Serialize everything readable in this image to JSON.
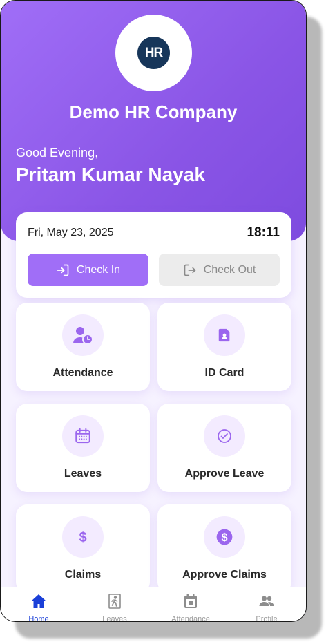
{
  "company": {
    "logo_text": "HR",
    "name": "Demo HR Company"
  },
  "greeting": {
    "salutation": "Good Evening,",
    "user_name": "Pritam Kumar Nayak"
  },
  "check": {
    "date": "Fri, May 23, 2025",
    "time": "18:11",
    "check_in_label": "Check In",
    "check_out_label": "Check Out"
  },
  "tiles": [
    {
      "label": "Attendance",
      "icon": "user-clock-icon"
    },
    {
      "label": "ID Card",
      "icon": "id-card-icon"
    },
    {
      "label": "Leaves",
      "icon": "calendar-icon"
    },
    {
      "label": "Approve Leave",
      "icon": "check-circle-icon"
    },
    {
      "label": "Claims",
      "icon": "dollar-icon"
    },
    {
      "label": "Approve Claims",
      "icon": "dollar-circle-icon"
    }
  ],
  "nav": [
    {
      "label": "Home",
      "icon": "home-icon",
      "active": true
    },
    {
      "label": "Leaves",
      "icon": "exit-door-icon",
      "active": false
    },
    {
      "label": "Attendance",
      "icon": "calendar-icon",
      "active": false
    },
    {
      "label": "Profile",
      "icon": "users-icon",
      "active": false
    }
  ],
  "colors": {
    "primary": "#a06ef7",
    "nav_active": "#1a3fd8",
    "logo_bg": "#17365a"
  }
}
